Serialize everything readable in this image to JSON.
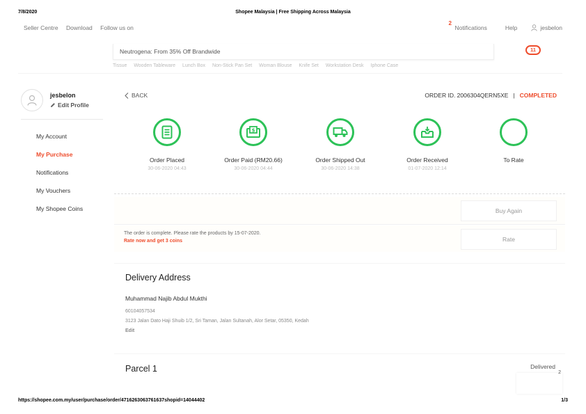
{
  "print": {
    "date": "7/8/2020",
    "title": "Shopee Malaysia | Free Shipping Across Malaysia",
    "url": "https://shopee.com.my/user/purchase/order/4716263063761637shopid=14044402",
    "page": "1/3"
  },
  "topbar": {
    "seller_centre": "Seller Centre",
    "download": "Download",
    "follow_us": "Follow us on",
    "notifications_count": "2",
    "notifications": "Notifications",
    "help": "Help",
    "username": "jesbelon"
  },
  "search": {
    "placeholder": "Neutrogena: From 35% Off Brandwide",
    "hints": [
      "Tissue",
      "Wooden Tableware",
      "Lunch Box",
      "Non-Stick Pan Set",
      "Woman Blouse",
      "Knife Set",
      "Workstation Desk",
      "Iphone Case"
    ]
  },
  "cart": {
    "count": "11"
  },
  "profile": {
    "username": "jesbelon",
    "edit_label": "Edit Profile"
  },
  "side_menu": [
    {
      "label": "My Account",
      "active": false
    },
    {
      "label": "My Purchase",
      "active": true
    },
    {
      "label": "Notifications",
      "active": false
    },
    {
      "label": "My Vouchers",
      "active": false
    },
    {
      "label": "My Shopee Coins",
      "active": false
    }
  ],
  "order": {
    "back_label": "BACK",
    "order_id_label": "ORDER ID. 2006304QERN5XE",
    "separator": "|",
    "status": "COMPLETED"
  },
  "steps": [
    {
      "label": "Order Placed",
      "time": "30-06-2020 04:43",
      "icon": "receipt-icon"
    },
    {
      "label": "Order Paid (RM20.66)",
      "time": "30-06-2020 04:44",
      "icon": "payment-icon"
    },
    {
      "label": "Order Shipped Out",
      "time": "30-06-2020 14:38",
      "icon": "truck-icon"
    },
    {
      "label": "Order Received",
      "time": "01-07-2020 12:14",
      "icon": "inbox-icon"
    },
    {
      "label": "To Rate",
      "time": "",
      "icon": "star-icon"
    }
  ],
  "actions": {
    "buy_again": "Buy Again",
    "rate": "Rate",
    "rate_note": "The order is complete. Please rate the products by 15-07-2020.",
    "rate_promo": "Rate now and get 3 coins"
  },
  "address": {
    "title": "Delivery Address",
    "name": "Muhammad Najib Abdul Mukthi",
    "phone": "60104057534",
    "street": "3123 Jalan Dato Haji Shuib 1/2, Sri Taman, Jalan Sultanah, Alor Setar, 05350, Kedah",
    "edit": "Edit"
  },
  "parcel": {
    "title": "Parcel 1",
    "status": "Delivered",
    "count": "2"
  },
  "colors": {
    "brand": "#ee4d2d",
    "step_green": "#2dc258"
  }
}
